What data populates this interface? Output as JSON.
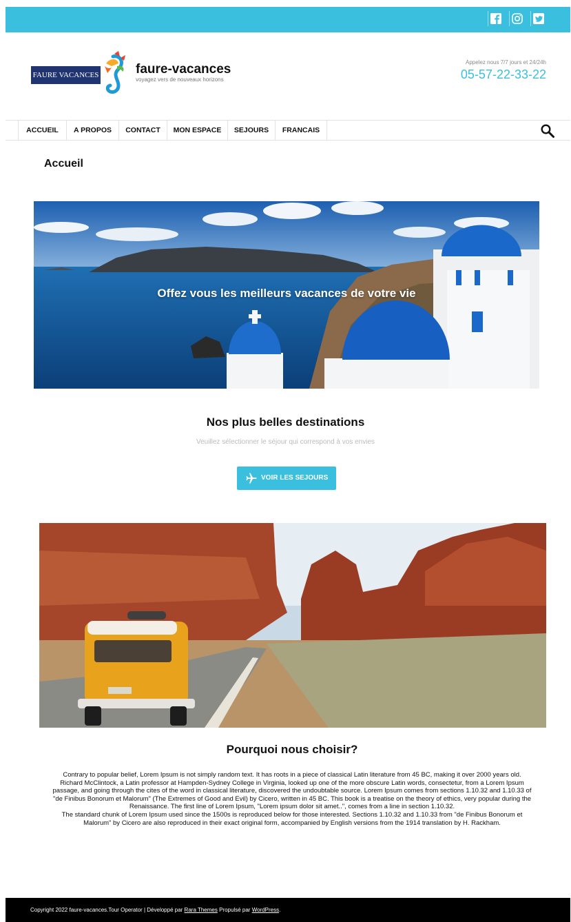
{
  "colors": {
    "accent": "#3bbfdf",
    "footer_bg": "#000000",
    "logo_bg": "#1f3470"
  },
  "social": {
    "icons": [
      "facebook-icon",
      "instagram-icon",
      "twitter-icon"
    ]
  },
  "header": {
    "logo_text": "FAURE VACANCES",
    "site_title": "faure-vacances",
    "tagline": "voyagez vers de nouveaux horizons",
    "call_note": "Appelez nous 7/7 jours et 24/24h",
    "phone": "05-57-22-33-22"
  },
  "nav": {
    "items": [
      {
        "label": "ACCUEIL"
      },
      {
        "label": "A PROPOS"
      },
      {
        "label": "CONTACT"
      },
      {
        "label": "MON ESPACE"
      },
      {
        "label": "SEJOURS"
      },
      {
        "label": "FRANCAIS"
      }
    ],
    "search_icon": "search-icon"
  },
  "page": {
    "title": "Accueil"
  },
  "hero": {
    "text": "Offez vous les meilleurs vacances de votre vie"
  },
  "destinations": {
    "title": "Nos plus belles destinations",
    "subtitle": "Veuillez sélectionner le séjour qui correspond à vos envies",
    "cta_label": "VOIR LES SEJOURS",
    "cta_icon": "airplane-icon"
  },
  "why": {
    "title": "Pourquoi nous choisir?",
    "paragraph1": "Contrary to popular belief, Lorem Ipsum is not simply random text. It has roots in a piece of classical Latin literature from 45 BC, making it over 2000 years old. Richard McClintock, a Latin professor at Hampden-Sydney College in Virginia, looked up one of the more obscure Latin words, consectetur, from a Lorem Ipsum passage, and going through the cites of the word in classical literature, discovered the undoubtable source. Lorem Ipsum comes from sections 1.10.32 and 1.10.33 of \"de Finibus Bonorum et Malorum\" (The Extremes of Good and Evil) by Cicero, written in 45 BC. This book is a treatise on the theory of ethics, very popular during the Renaissance. The first line of Lorem Ipsum, \"Lorem ipsum dolor sit amet..\", comes from a line in section 1.10.32.",
    "paragraph2": "The standard chunk of Lorem Ipsum used since the 1500s is reproduced below for those interested. Sections 1.10.32 and 1.10.33 from \"de Finibus Bonorum et Malorum\" by Cicero are also reproduced in their exact original form, accompanied by English versions from the 1914 translation by H. Rackham."
  },
  "footer": {
    "copyright": "Copyright 2022 faure-vacances.Tour Operator | Développé par ",
    "rara_link": "Rara Themes",
    "powered": " Propulsé par ",
    "wp_link": "WordPress",
    "end": "."
  }
}
